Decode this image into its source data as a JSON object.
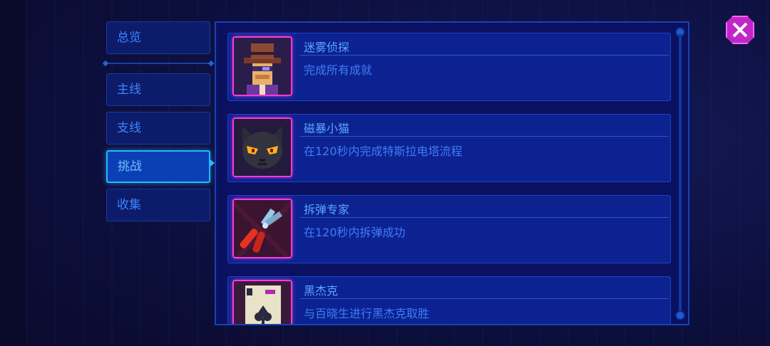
{
  "tabs": [
    {
      "label": "总览",
      "active": false
    },
    {
      "label": "主线",
      "active": false
    },
    {
      "label": "支线",
      "active": false
    },
    {
      "label": "挑战",
      "active": true
    },
    {
      "label": "收集",
      "active": false
    }
  ],
  "achievements": [
    {
      "title": "迷雾侦探",
      "description": "完成所有成就",
      "icon": "detective-icon"
    },
    {
      "title": "磁暴小猫",
      "description": "在120秒内完成特斯拉电塔流程",
      "icon": "black-cat-icon"
    },
    {
      "title": "拆弹专家",
      "description": "在120秒内拆弹成功",
      "icon": "wire-cutter-icon"
    },
    {
      "title": "黑杰克",
      "description": "与百晓生进行黑杰克取胜",
      "icon": "playing-card-icon"
    }
  ],
  "colors": {
    "panel_bg": "#0a1160",
    "row_bg": "#0c2290",
    "accent_blue": "#23b9ff",
    "icon_border": "#ff3bd6",
    "close_button": "#c026c8"
  }
}
